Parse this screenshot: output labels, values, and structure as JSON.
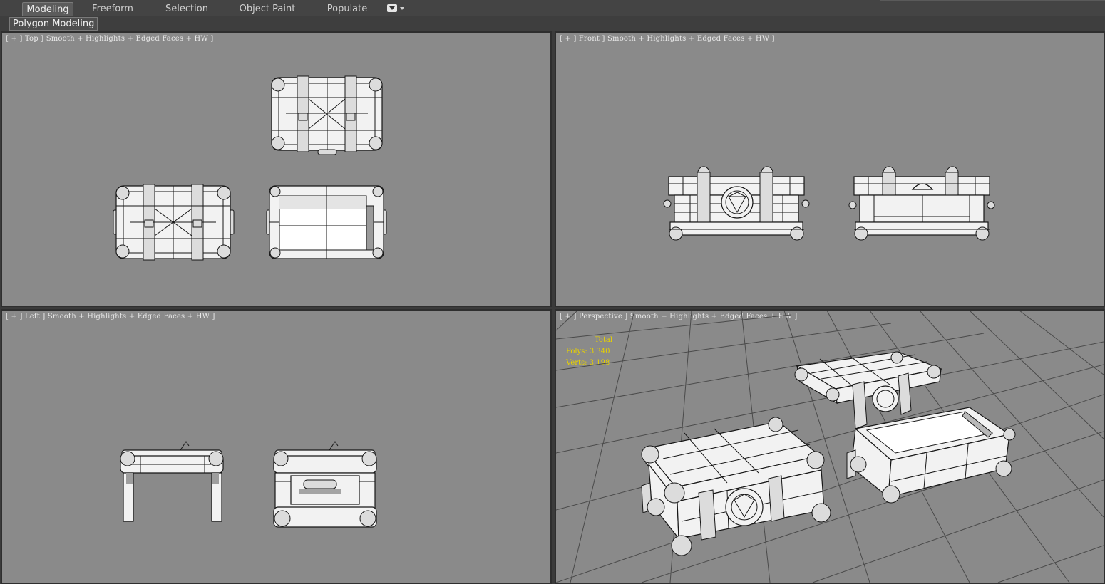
{
  "ribbon": {
    "tabs": [
      {
        "label": "Modeling",
        "active": true
      },
      {
        "label": "Freeform",
        "active": false
      },
      {
        "label": "Selection",
        "active": false
      },
      {
        "label": "Object Paint",
        "active": false
      },
      {
        "label": "Populate",
        "active": false
      }
    ],
    "dropdown_icon": "ribbon-options-icon",
    "subtab": "Polygon Modeling"
  },
  "viewports": {
    "top": {
      "label": "[ + ] Top ] Smooth + Highlights + Edged Faces + HW ]"
    },
    "front": {
      "label": "[ + ] Front ] Smooth + Highlights + Edged Faces + HW ]"
    },
    "left": {
      "label": "[ + ] Left ] Smooth + Highlights + Edged Faces + HW ]"
    },
    "perspective": {
      "label": "[ + ] Perspective ] Smooth + Highlights + Edged Faces + HW ]"
    }
  },
  "stats": {
    "total_label": "Total",
    "polys": "Polys: 3,340",
    "verts": "Verts: 3,198"
  },
  "colors": {
    "viewport_bg": "#8a8a8a",
    "ui_bg": "#444444",
    "stats_text": "#e7d100",
    "wire": "#161616",
    "mesh": "#f2f2f2"
  }
}
